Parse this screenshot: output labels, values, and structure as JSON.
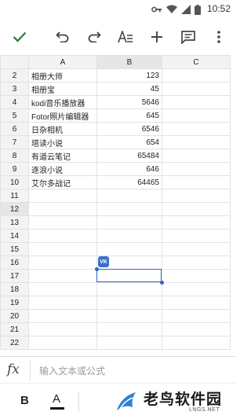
{
  "status_bar": {
    "time": "10:52",
    "icons": [
      "key-icon",
      "wifi-icon",
      "signal-icon",
      "battery-icon"
    ]
  },
  "toolbar": {
    "buttons": [
      "check-icon",
      "undo-icon",
      "redo-icon",
      "text-format-icon",
      "add-icon",
      "comment-icon",
      "more-vert-icon"
    ]
  },
  "sheet": {
    "columns": [
      "A",
      "B",
      "C"
    ],
    "rows": [
      {
        "num": "2",
        "a": "相册大师",
        "b": "123"
      },
      {
        "num": "3",
        "a": "相册宝",
        "b": "45"
      },
      {
        "num": "4",
        "a": "kodi音乐播放器",
        "b": "5646"
      },
      {
        "num": "5",
        "a": "Fotor照片编辑器",
        "b": "645"
      },
      {
        "num": "6",
        "a": "日杂相机",
        "b": "6546"
      },
      {
        "num": "7",
        "a": "塔读小说",
        "b": "654"
      },
      {
        "num": "8",
        "a": "有道云笔记",
        "b": "65484"
      },
      {
        "num": "9",
        "a": "逐浪小说",
        "b": "646"
      },
      {
        "num": "10",
        "a": "艾尔多战记",
        "b": "64465"
      },
      {
        "num": "11",
        "a": "",
        "b": ""
      },
      {
        "num": "12",
        "a": "",
        "b": ""
      },
      {
        "num": "13",
        "a": "",
        "b": ""
      },
      {
        "num": "14",
        "a": "",
        "b": ""
      },
      {
        "num": "15",
        "a": "",
        "b": ""
      },
      {
        "num": "16",
        "a": "",
        "b": ""
      },
      {
        "num": "17",
        "a": "",
        "b": ""
      },
      {
        "num": "18",
        "a": "",
        "b": ""
      },
      {
        "num": "19",
        "a": "",
        "b": ""
      },
      {
        "num": "20",
        "a": "",
        "b": ""
      },
      {
        "num": "21",
        "a": "",
        "b": ""
      },
      {
        "num": "22",
        "a": "",
        "b": ""
      }
    ],
    "selected_cell": "B12",
    "vk_badge": "VK"
  },
  "formula_bar": {
    "fx_label": "fx",
    "placeholder": "输入文本或公式"
  },
  "format_bar": {
    "bold_label": "B",
    "text_color_label": "A",
    "text_color": "#111111"
  },
  "watermark": {
    "text": "老鸟软件园",
    "sub": "LNGS.NET"
  },
  "colors": {
    "accent": "#2a66c6",
    "header_bg": "#f3f3f3",
    "check": "#1e7f3c"
  }
}
